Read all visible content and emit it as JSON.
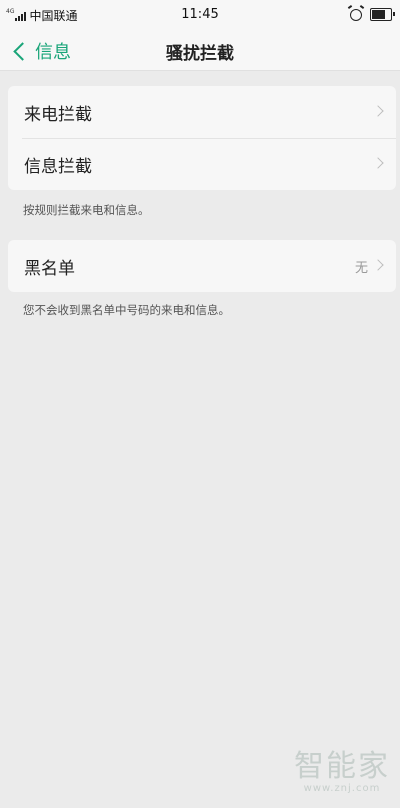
{
  "status_bar": {
    "carrier": "中国联通",
    "network_tag": "4G",
    "time": "11:45"
  },
  "nav": {
    "back_label": "信息",
    "title": "骚扰拦截"
  },
  "group1": {
    "items": [
      {
        "label": "来电拦截"
      },
      {
        "label": "信息拦截"
      }
    ],
    "hint": "按规则拦截来电和信息。"
  },
  "group2": {
    "items": [
      {
        "label": "黑名单",
        "value": "无"
      }
    ],
    "hint": "您不会收到黑名单中号码的来电和信息。"
  },
  "watermark": {
    "cn": "智能家",
    "en": "www.znj.com"
  },
  "colors": {
    "accent": "#1aa579",
    "background": "#ebebeb",
    "card": "#f7f7f7"
  }
}
